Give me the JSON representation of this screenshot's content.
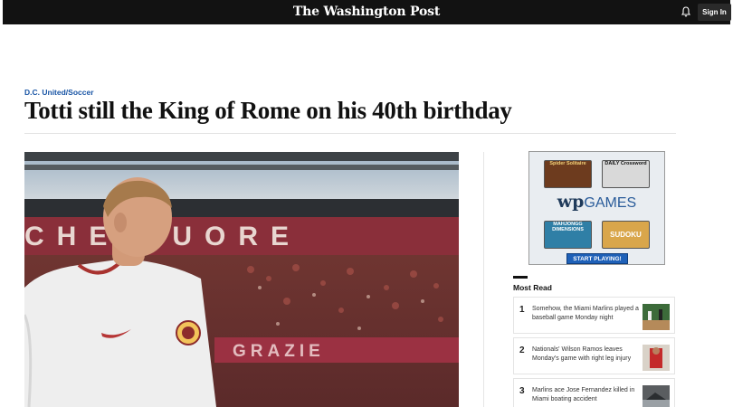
{
  "header": {
    "masthead": "The Washington Post",
    "signin_label": "Sign In"
  },
  "article": {
    "kicker": "D.C. United/Soccer",
    "headline": "Totti still the King of Rome on his 40th birthday",
    "banner_text": "CHE CUORE"
  },
  "ad": {
    "games": [
      "Spider Solitaire",
      "DAILY Crossword",
      "MAHJONGG DIMENSIONS",
      "SUDOKU"
    ],
    "brand_wp": "wp",
    "brand_games": "GAMES",
    "cta": "START PLAYING!"
  },
  "most_read": {
    "title": "Most Read",
    "items": [
      {
        "rank": "1",
        "text": "Somehow, the Miami Marlins played a baseball game Monday night"
      },
      {
        "rank": "2",
        "text": "Nationals' Wilson Ramos leaves Monday's game with right leg injury"
      },
      {
        "rank": "3",
        "text": "Marlins ace Jose Fernandez killed in Miami boating accident"
      }
    ]
  },
  "icons": {
    "bell": "bell-icon",
    "jersey_logo": "as-roma-crest-icon",
    "jersey_brand": "swoosh-icon"
  },
  "colors": {
    "topbar": "#121212",
    "kicker": "#1955a5",
    "cta": "#1f61b8"
  }
}
